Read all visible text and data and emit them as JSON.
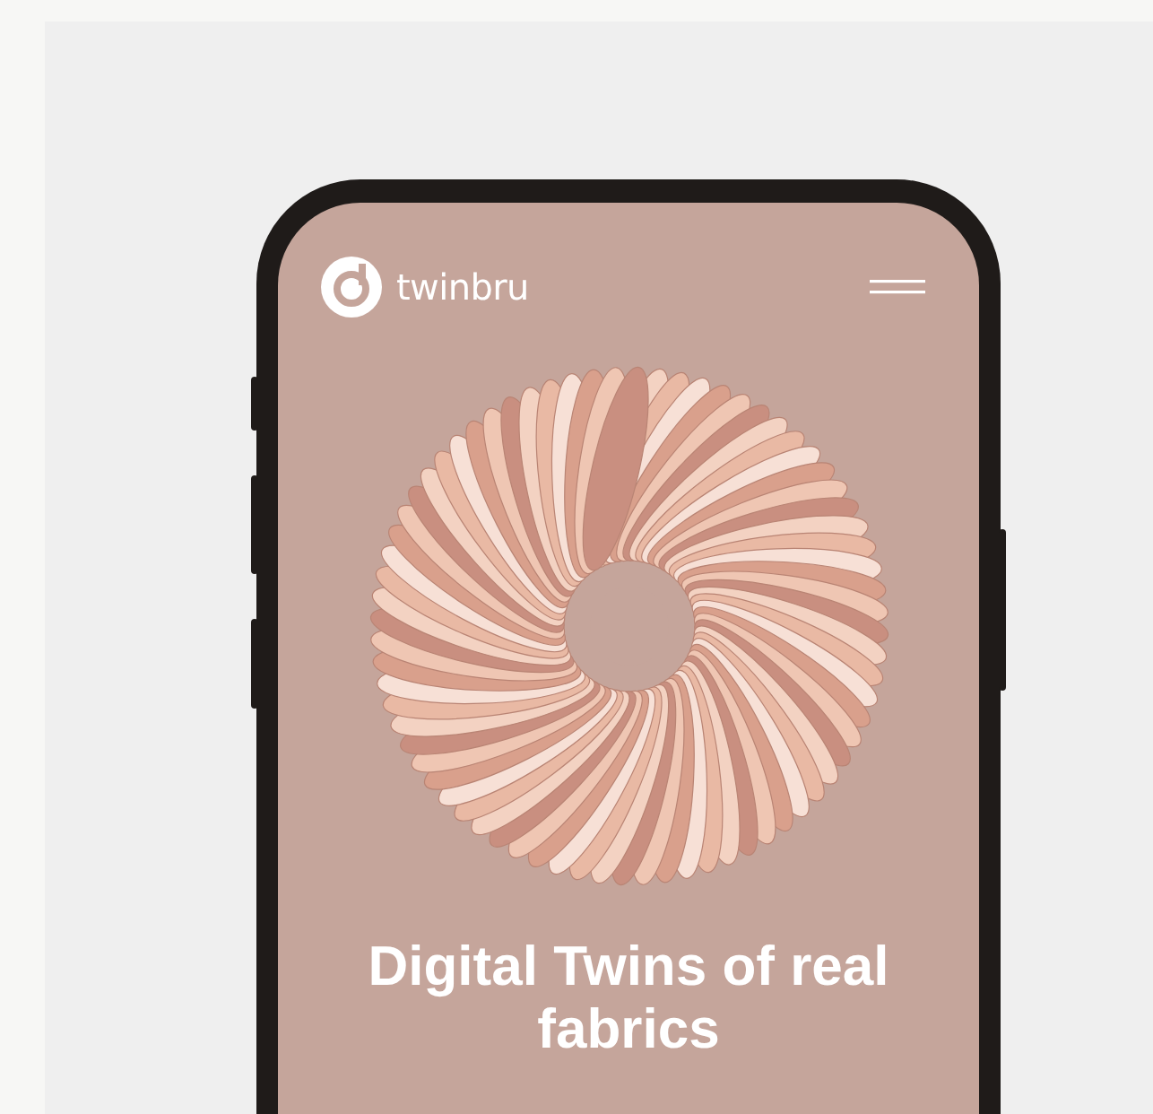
{
  "brand": {
    "name": "twinbru"
  },
  "headline": "Digital Twins of real fabrics"
}
